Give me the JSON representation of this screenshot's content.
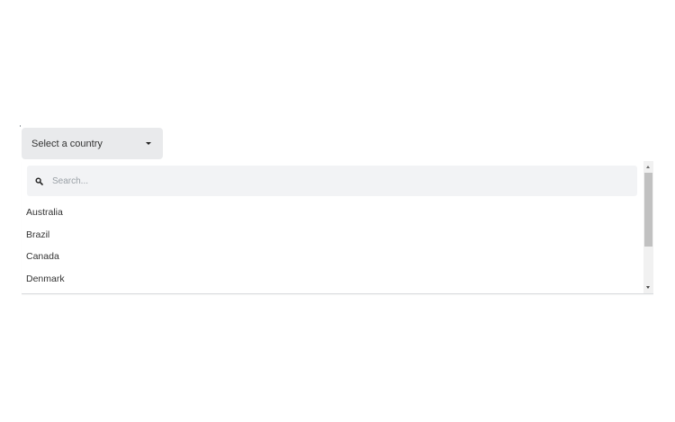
{
  "select": {
    "label": "Select a country",
    "caret_icon": "caret-down-icon"
  },
  "search": {
    "icon": "search-icon",
    "placeholder": "Search...",
    "value": ""
  },
  "options": [
    {
      "label": "Australia"
    },
    {
      "label": "Brazil"
    },
    {
      "label": "Canada"
    },
    {
      "label": "Denmark"
    }
  ],
  "colors": {
    "trigger_bg": "#e9eaec",
    "search_bg": "#f2f3f5",
    "text": "#333333",
    "placeholder": "#9aa0a6",
    "scroll_thumb": "#c1c1c1"
  }
}
